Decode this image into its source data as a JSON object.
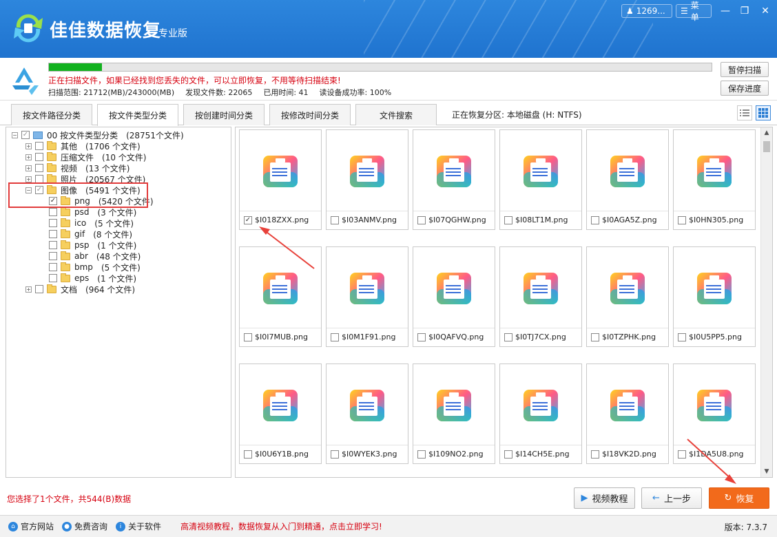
{
  "header": {
    "title": "佳佳数据恢复",
    "edition": "专业版",
    "user": "1269...",
    "menu": "菜单"
  },
  "scan": {
    "progress_percent": 8,
    "message": "正在扫描文件，如果已经找到您丢失的文件，可以立即恢复，不用等待扫描结束!",
    "range": "扫描范围: 21712(MB)/243000(MB)",
    "found": "发现文件数: 22065",
    "elapsed": "已用时间: 41",
    "read_rate": "读设备成功率: 100%",
    "pause_btn": "暂停扫描",
    "save_btn": "保存进度"
  },
  "tabs": [
    "按文件路径分类",
    "按文件类型分类",
    "按创建时间分类",
    "按修改时间分类",
    "文件搜索"
  ],
  "active_tab": 1,
  "partition": "正在恢复分区: 本地磁盘 (H: NTFS)",
  "tree": [
    {
      "label": "00  按文件类型分类",
      "count": "(28751个文件)",
      "level": 0,
      "check": "partial",
      "expander": "−"
    },
    {
      "label": "其他",
      "count": "(1706 个文件)",
      "level": 1,
      "check": "none",
      "expander": "+"
    },
    {
      "label": "压缩文件",
      "count": "(10 个文件)",
      "level": 1,
      "check": "none",
      "expander": "+"
    },
    {
      "label": "视频",
      "count": "(13 个文件)",
      "level": 1,
      "check": "none",
      "expander": "+"
    },
    {
      "label": "照片",
      "count": "(20567 个文件)",
      "level": 1,
      "check": "none",
      "expander": "+"
    },
    {
      "label": "图像",
      "count": "(5491 个文件)",
      "level": 1,
      "check": "partial",
      "expander": "−"
    },
    {
      "label": "png",
      "count": "(5420 个文件)",
      "level": 2,
      "check": "checked",
      "expander": ""
    },
    {
      "label": "psd",
      "count": "(3 个文件)",
      "level": 2,
      "check": "none",
      "expander": ""
    },
    {
      "label": "ico",
      "count": "(5 个文件)",
      "level": 2,
      "check": "none",
      "expander": ""
    },
    {
      "label": "gif",
      "count": "(8 个文件)",
      "level": 2,
      "check": "none",
      "expander": ""
    },
    {
      "label": "psp",
      "count": "(1 个文件)",
      "level": 2,
      "check": "none",
      "expander": ""
    },
    {
      "label": "abr",
      "count": "(48 个文件)",
      "level": 2,
      "check": "none",
      "expander": ""
    },
    {
      "label": "bmp",
      "count": "(5 个文件)",
      "level": 2,
      "check": "none",
      "expander": ""
    },
    {
      "label": "eps",
      "count": "(1 个文件)",
      "level": 2,
      "check": "none",
      "expander": ""
    },
    {
      "label": "文档",
      "count": "(964 个文件)",
      "level": 1,
      "check": "none",
      "expander": "+"
    }
  ],
  "files": [
    {
      "name": "$I018ZXX.png",
      "checked": true
    },
    {
      "name": "$I03ANMV.png",
      "checked": false
    },
    {
      "name": "$I07QGHW.png",
      "checked": false
    },
    {
      "name": "$I08LT1M.png",
      "checked": false
    },
    {
      "name": "$I0AGA5Z.png",
      "checked": false
    },
    {
      "name": "$I0HN305.png",
      "checked": false
    },
    {
      "name": "$I0I7MUB.png",
      "checked": false
    },
    {
      "name": "$I0M1F91.png",
      "checked": false
    },
    {
      "name": "$I0QAFVQ.png",
      "checked": false
    },
    {
      "name": "$I0TJ7CX.png",
      "checked": false
    },
    {
      "name": "$I0TZPHK.png",
      "checked": false
    },
    {
      "name": "$I0U5PP5.png",
      "checked": false
    },
    {
      "name": "$I0U6Y1B.png",
      "checked": false
    },
    {
      "name": "$I0WYEK3.png",
      "checked": false
    },
    {
      "name": "$I109NO2.png",
      "checked": false
    },
    {
      "name": "$I14CH5E.png",
      "checked": false
    },
    {
      "name": "$I18VK2D.png",
      "checked": false
    },
    {
      "name": "$I1DA5U8.png",
      "checked": false
    }
  ],
  "footer": {
    "selection": "您选择了1个文件，共544(B)数据",
    "video_btn": "视频教程",
    "prev_btn": "上一步",
    "recover_btn": "恢复"
  },
  "status": {
    "website": "官方网站",
    "consult": "免费咨询",
    "about": "关于软件",
    "promo": "高清视频教程，数据恢复从入门到精通，点击立即学习!",
    "version": "版本: 7.3.7"
  },
  "colors": {
    "header_blue": "#2d86dd",
    "progress_green": "#12b11f",
    "alert_red": "#d6000f",
    "recover_orange": "#f26a1b"
  }
}
